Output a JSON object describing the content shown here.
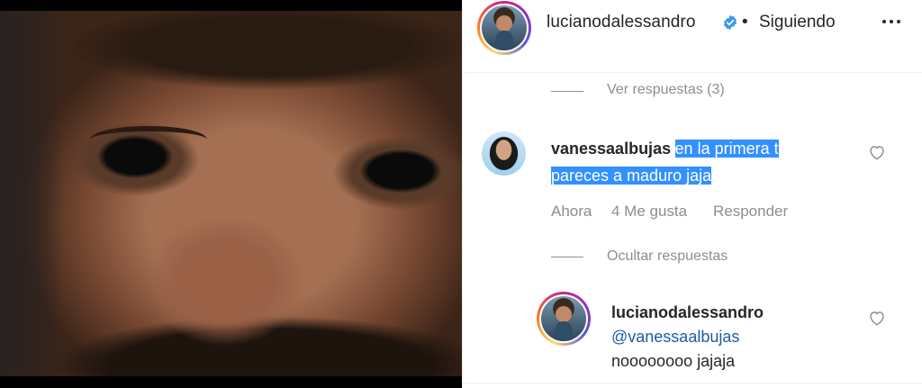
{
  "post": {
    "author": "lucianodalessandro",
    "separator": "•",
    "follow_status": "Siguiendo"
  },
  "thread": {
    "view_replies": "Ver respuestas (3)",
    "hide_replies": "Ocultar respuestas"
  },
  "comment": {
    "username": "vanessaalbujas",
    "text_line1_highlight": "en la primera t",
    "text_line2_highlight": "pareces a maduro jaja",
    "time": "Ahora",
    "likes": "4 Me gusta",
    "reply_label": "Responder"
  },
  "reply": {
    "username": "lucianodalessandro",
    "mention": "@vanessaalbujas",
    "text": "noooooooo jajaja"
  },
  "colors": {
    "verified": "#3897f0",
    "highlight": "#3390ff",
    "mention": "#1e5aa8",
    "secondary_text": "#8e8e8e"
  },
  "icons": [
    "verified-badge-icon",
    "more-options-icon",
    "heart-icon"
  ]
}
